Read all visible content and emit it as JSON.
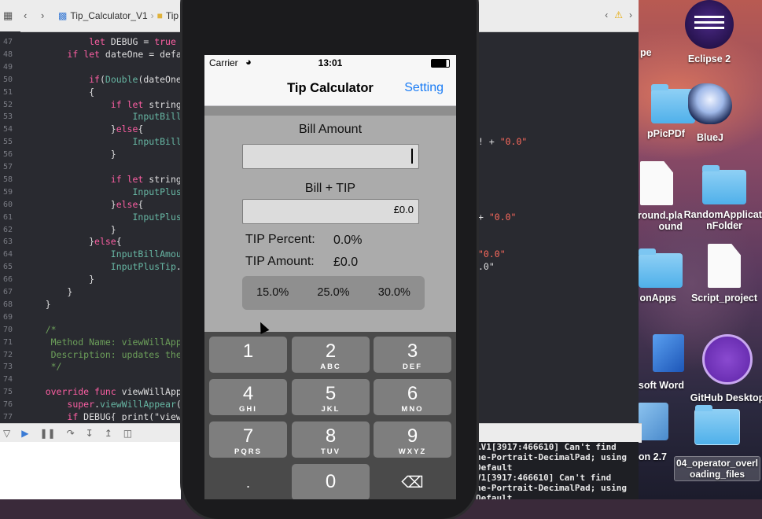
{
  "desktop": {
    "icons": [
      {
        "label": "Eclipse 2"
      },
      {
        "label": "pPicPDf"
      },
      {
        "label": "BlueJ"
      },
      {
        "label": "round.pla\nound"
      },
      {
        "label": "RandomApplicati\nnFolder"
      },
      {
        "label": "onApps"
      },
      {
        "label": "Script_project"
      },
      {
        "label": "soft Word"
      },
      {
        "label": "GitHub Desktop"
      },
      {
        "label": "on 2.7"
      },
      {
        "label": "04_operator_overl\noading_files"
      },
      {
        "label": "pe"
      }
    ]
  },
  "xcode": {
    "breadcrumb_project": "Tip_Calculator_V1",
    "breadcrumb_folder": "Tip",
    "line_numbers": [
      "47",
      "48",
      "49",
      "50",
      "51",
      "52",
      "53",
      "54",
      "55",
      "56",
      "57",
      "58",
      "59",
      "60",
      "61",
      "62",
      "63",
      "64",
      "65",
      "66",
      "67",
      "68",
      "69",
      "70",
      "71",
      "72",
      "73",
      "74",
      "75",
      "76",
      "77"
    ],
    "code_lines": [
      "            let DEBUG = true",
      "        if let dateOne = defau",
      "",
      "            if(Double(dateOne.",
      "            {",
      "                if let stringO",
      "                    InputBill",
      "                }else{",
      "                    InputBill",
      "                }",
      "",
      "                if let string",
      "                    InputPlus",
      "                }else{",
      "                    InputPlusT",
      "                }",
      "            }else{",
      "                InputBillAmour",
      "                InputPlusTip.t",
      "            }",
      "        }",
      "    }",
      "",
      "    /*",
      "     Method Name: viewWillAppea",
      "     Description: updates the",
      "     */",
      "",
      "    override func viewWillAppe",
      "        super.viewWillAppear(a",
      "        if DEBUG{ print(\"view "
    ],
    "right_fragments": [
      {
        "line": 8,
        "text": "! + \"0.0\""
      },
      {
        "line": 14,
        "text": "+ \"0.0\""
      },
      {
        "line": 17,
        "text": "\"0.0\""
      },
      {
        "line": 18,
        "text": ".0\""
      }
    ],
    "console_lines": [
      "…V1[3917:466610] Can't find",
      "he-Portrait-DecimalPad; using",
      "Default",
      "V1[3917:466610] Can't find",
      "he-Portrait-DecimalPad; using",
      "Default"
    ]
  },
  "simulator": {
    "carrier": "Carrier",
    "time": "13:01",
    "title": "Tip Calculator",
    "setting": "Setting",
    "bill_amount_label": "Bill Amount",
    "bill_amount_value": "",
    "bill_tip_label": "Bill + TIP",
    "bill_tip_value": "£0.0",
    "tip_percent_label": "TIP Percent:",
    "tip_percent_value": "0.0%",
    "tip_amount_label": "TIP Amount:",
    "tip_amount_value": "£0.0",
    "segments": [
      "15.0%",
      "25.0%",
      "30.0%"
    ],
    "keys": [
      {
        "num": "1",
        "sub": ""
      },
      {
        "num": "2",
        "sub": "ABC"
      },
      {
        "num": "3",
        "sub": "DEF"
      },
      {
        "num": "4",
        "sub": "GHI"
      },
      {
        "num": "5",
        "sub": "JKL"
      },
      {
        "num": "6",
        "sub": "MNO"
      },
      {
        "num": "7",
        "sub": "PQRS"
      },
      {
        "num": "8",
        "sub": "TUV"
      },
      {
        "num": "9",
        "sub": "WXYZ"
      },
      {
        "num": ".",
        "sub": ""
      },
      {
        "num": "0",
        "sub": ""
      },
      {
        "num": "⌫",
        "sub": ""
      }
    ]
  },
  "colors": {
    "accent": "#1a7cf5",
    "keyword": "#fc5fa3",
    "string": "#fc6a5d",
    "comment": "#6c9f5a"
  }
}
